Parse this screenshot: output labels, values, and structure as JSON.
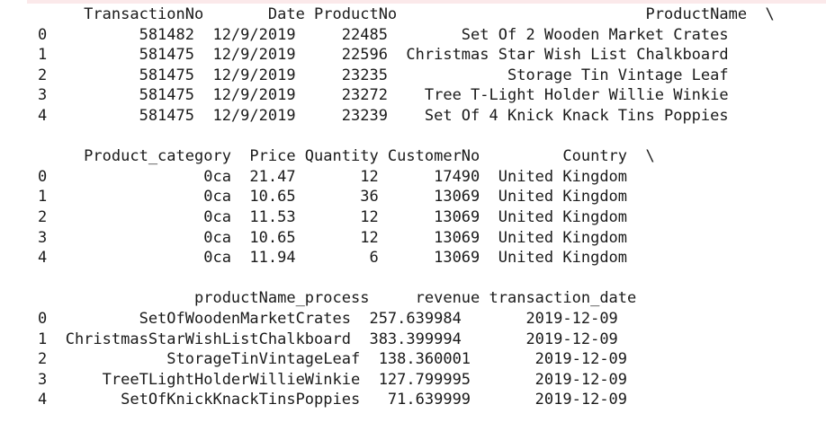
{
  "blocks": [
    {
      "header": "     TransactionNo       Date ProductNo                           ProductName  \\",
      "rows": [
        "0          581482  12/9/2019     22485        Set Of 2 Wooden Market Crates",
        "1          581475  12/9/2019     22596  Christmas Star Wish List Chalkboard",
        "2          581475  12/9/2019     23235             Storage Tin Vintage Leaf",
        "3          581475  12/9/2019     23272    Tree T-Light Holder Willie Winkie",
        "4          581475  12/9/2019     23239    Set Of 4 Knick Knack Tins Poppies"
      ]
    },
    {
      "header": "     Product_category  Price Quantity CustomerNo         Country  \\",
      "rows": [
        "0                 0ca  21.47       12      17490  United Kingdom",
        "1                 0ca  10.65       36      13069  United Kingdom",
        "2                 0ca  11.53       12      13069  United Kingdom",
        "3                 0ca  10.65       12      13069  United Kingdom",
        "4                 0ca  11.94        6      13069  United Kingdom"
      ]
    },
    {
      "header": "                 productName_process     revenue transaction_date",
      "rows": [
        "0          SetOfWoodenMarketCrates  257.639984       2019-12-09",
        "1  ChristmasStarWishListChalkboard  383.399994       2019-12-09",
        "2             StorageTinVintageLeaf  138.360001       2019-12-09",
        "3      TreeTLightHolderWillieWinkie  127.799995       2019-12-09",
        "4        SetOfKnickKnackTinsPoppies   71.639999       2019-12-09"
      ]
    }
  ]
}
